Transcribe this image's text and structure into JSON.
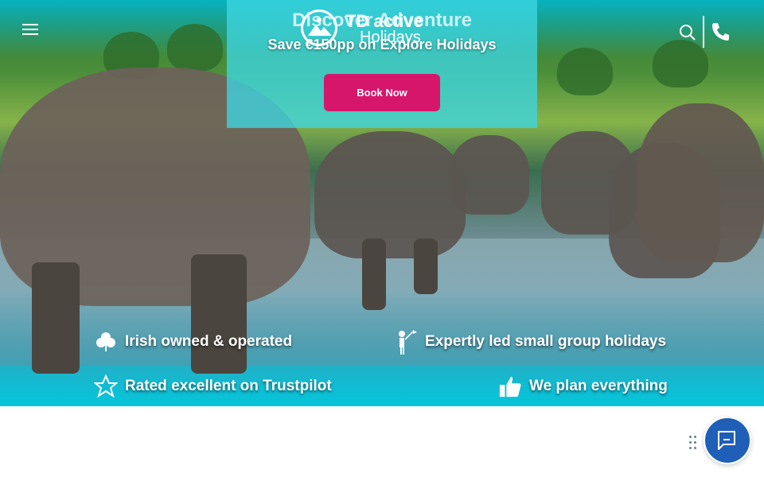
{
  "promo": {
    "title": "Discover Adventure",
    "subtitle": "Save €150pp on Explore Holidays",
    "button": "Book Now"
  },
  "logo": {
    "brand": "TD active",
    "tagline": "Holidays"
  },
  "header": {
    "menu_icon": "hamburger-icon",
    "search_icon": "search-icon",
    "phone_icon": "phone-icon"
  },
  "features": [
    {
      "label": "Irish owned & operated",
      "icon": "shamrock-icon"
    },
    {
      "label": "Expertly led small group holidays",
      "icon": "guide-flag-icon"
    },
    {
      "label": "Rated excellent on Trustpilot",
      "icon": "star-icon"
    },
    {
      "label": "We plan everything",
      "icon": "thumbs-up-icon"
    }
  ],
  "chat": {
    "icon": "chat-icon"
  },
  "colors": {
    "accent": "#d6166b",
    "teal": "#3ed6e2",
    "chat": "#1f5fb8"
  }
}
